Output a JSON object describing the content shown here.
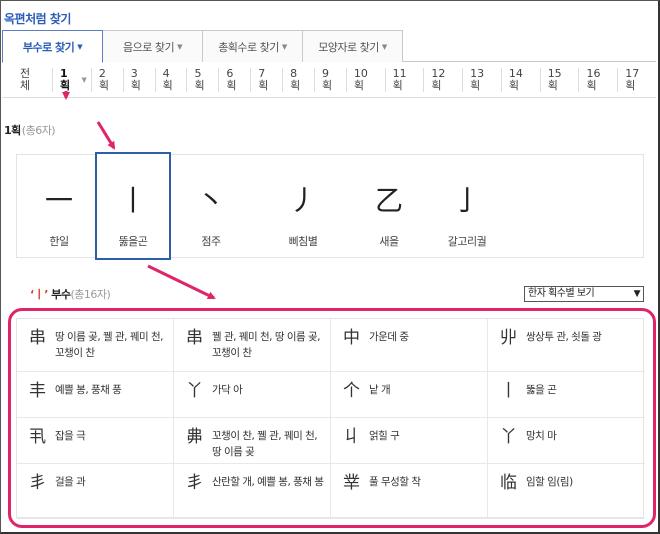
{
  "title": "옥편처럼 찾기",
  "tabs": [
    {
      "label": "부수로 찾기",
      "active": true
    },
    {
      "label": "음으로 찾기",
      "active": false
    },
    {
      "label": "총획수로 찾기",
      "active": false
    },
    {
      "label": "모양자로 찾기",
      "active": false
    }
  ],
  "strokes": [
    "전체",
    "1획",
    "2획",
    "3획",
    "4획",
    "5획",
    "6획",
    "7획",
    "8획",
    "9획",
    "10획",
    "11획",
    "12획",
    "13획",
    "14획",
    "15획",
    "16획",
    "17획"
  ],
  "selected_stroke": "1획",
  "count_section": {
    "label": "1획",
    "count": "(총6자)"
  },
  "radicals": [
    {
      "glyph": "一",
      "name": "한일"
    },
    {
      "glyph": "丨",
      "name": "뚫을곤"
    },
    {
      "glyph": "丶",
      "name": "점주"
    },
    {
      "glyph": "丿",
      "name": "삐침별"
    },
    {
      "glyph": "乙",
      "name": "새을"
    },
    {
      "glyph": "亅",
      "name": "갈고리궐"
    }
  ],
  "selected_radical": {
    "open_quote": "‘",
    "glyph": "丨",
    "close_quote": "’",
    "label": "부수",
    "count": "(총16자)"
  },
  "view_select": {
    "value": "한자 획수별 보기"
  },
  "characters": [
    {
      "ch": "串",
      "meaning": "땅 이름 곶, 꿸 관, 꿰미 천, 꼬챙이 찬"
    },
    {
      "ch": "串",
      "meaning": "꿸 관, 꿰미 천, 땅 이름 곶, 꼬챙이 찬"
    },
    {
      "ch": "中",
      "meaning": "가운데 중"
    },
    {
      "ch": "丱",
      "meaning": "쌍상투 관, 쇳돌 광"
    },
    {
      "ch": "丰",
      "meaning": "예쁠 봉, 풍채 풍"
    },
    {
      "ch": "丫",
      "meaning": "가닥 아"
    },
    {
      "ch": "个",
      "meaning": "낱 개"
    },
    {
      "ch": "丨",
      "meaning": "뚫을 곤"
    },
    {
      "ch": "丮",
      "meaning": "잡을 극"
    },
    {
      "ch": "丳",
      "meaning": "꼬챙이 찬, 꿸 관, 꿰미 천, 땅 이름 곶"
    },
    {
      "ch": "丩",
      "meaning": "얽힐 구"
    },
    {
      "ch": "丫",
      "meaning": "망치 마"
    },
    {
      "ch": "丯",
      "meaning": "걸을 과"
    },
    {
      "ch": "丯",
      "meaning": "산란할 개, 예쁠 봉, 풍채 봉"
    },
    {
      "ch": "丵",
      "meaning": "풀 무성할 착"
    },
    {
      "ch": "临",
      "meaning": "임할 임(림)"
    }
  ],
  "colors": {
    "accent": "#2a5cb8",
    "highlight": "#e0246a",
    "radical_red": "#d63a2e"
  }
}
